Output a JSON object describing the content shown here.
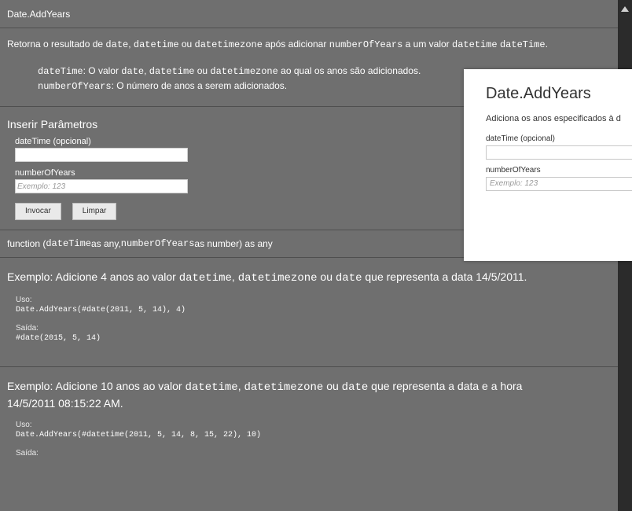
{
  "header": {
    "title": "Date.AddYears"
  },
  "description": {
    "parts": [
      "Retorna o resultado de ",
      "date",
      ", ",
      "datetime",
      " ou ",
      "datetimezone",
      " após adicionar ",
      "numberOfYears",
      " a um valor ",
      "datetime",
      " ",
      "dateTime",
      "."
    ]
  },
  "params": [
    {
      "name": "dateTime",
      "text": ": O valor ",
      "t1": "date",
      "s1": ", ",
      "t2": "datetime",
      "s2": " ou ",
      "t3": "datetimezone",
      "tail": " ao qual os anos são adicionados."
    },
    {
      "name": "numberOfYears",
      "text": ": O número de anos a serem adicionados."
    }
  ],
  "invoke": {
    "title": "Inserir Parâmetros",
    "field1_label": "dateTime (opcional)",
    "field1_value": "",
    "field2_label": "numberOfYears",
    "field2_placeholder": "Exemplo: 123",
    "invoke_label": "Invocar",
    "clear_label": "Limpar"
  },
  "signature": {
    "a": "function (",
    "b": "dateTime",
    "c": " as any, ",
    "d": "numberOfYears",
    "e": " as number) as any"
  },
  "examples": [
    {
      "title_a": "Exemplo: Adicione 4 anos ao valor ",
      "title_b": "datetime",
      "title_c": ", ",
      "title_d": "datetimezone",
      "title_e": " ou ",
      "title_f": "date",
      "title_g": " que representa a data 14/5/2011.",
      "uso_label": "Uso:",
      "uso_code": "Date.AddYears(#date(2011, 5, 14), 4)",
      "saida_label": "Saída:",
      "saida_code": "#date(2015, 5, 14)"
    },
    {
      "title_a": "Exemplo: Adicione 10 anos ao valor ",
      "title_b": "datetime",
      "title_c": ", ",
      "title_d": "datetimezone",
      "title_e": " ou ",
      "title_f": "date",
      "title_g": " que representa a data e a hora",
      "title_line2": "14/5/2011 08:15:22 AM.",
      "uso_label": "Uso:",
      "uso_code": "Date.AddYears(#datetime(2011, 5, 14, 8, 15, 22), 10)",
      "saida_label": "Saída:"
    }
  ],
  "card": {
    "title": "Date.AddYears",
    "desc": "Adiciona os anos especificados à d",
    "field1_label": "dateTime (opcional)",
    "field2_label": "numberOfYears",
    "field2_placeholder": "Exemplo: 123"
  }
}
